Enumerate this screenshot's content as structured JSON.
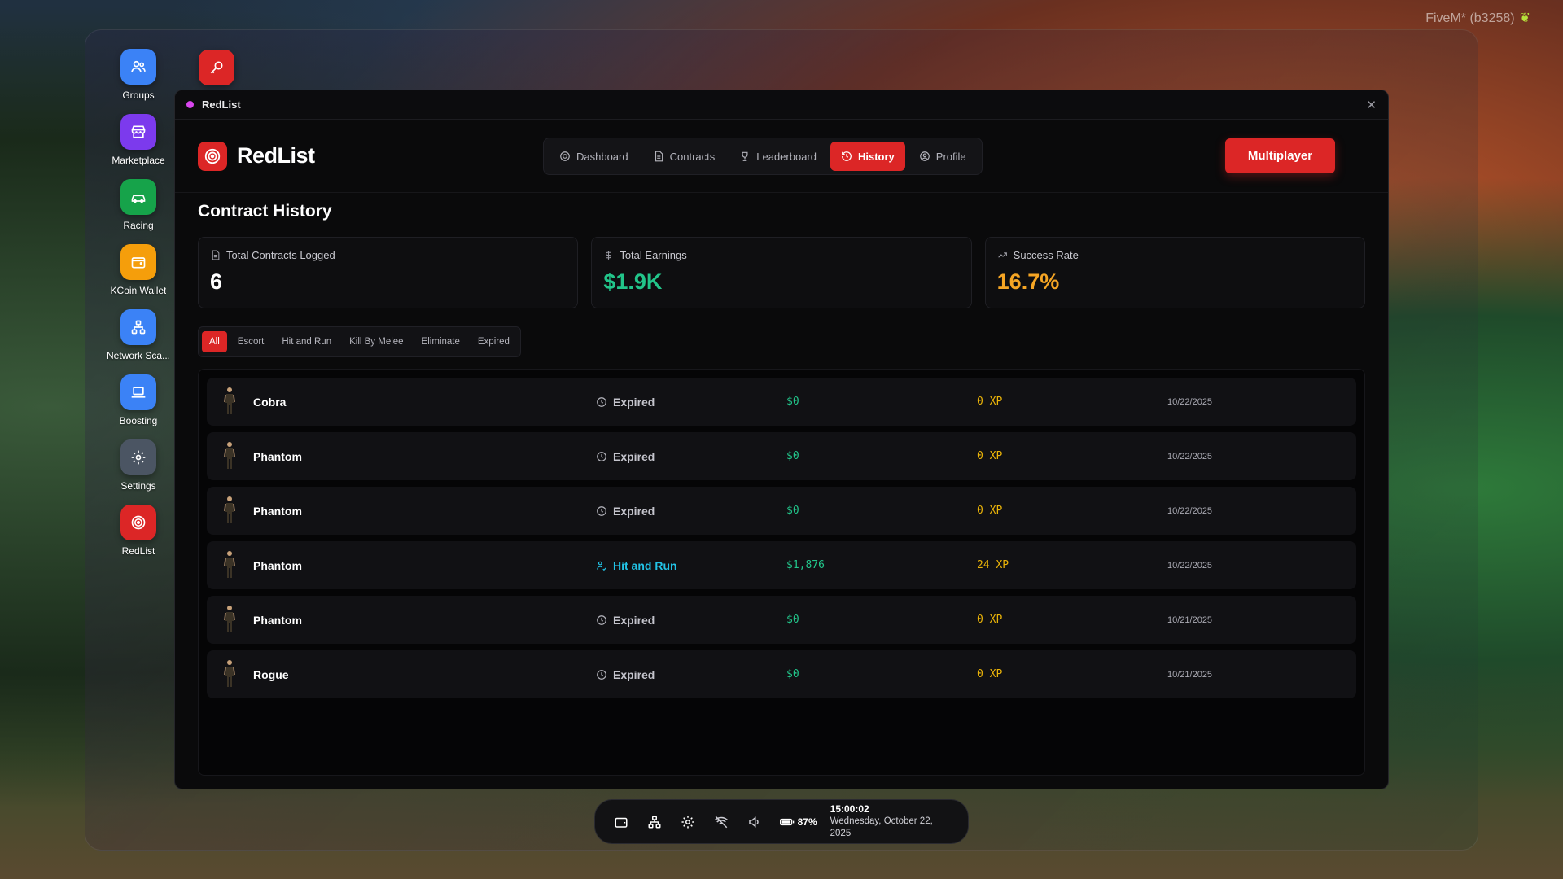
{
  "overlay": {
    "game_tag": "FiveM* (b3258)"
  },
  "dock": {
    "items": [
      {
        "label": "Groups",
        "icon": "users-icon",
        "color": "#3b82f6"
      },
      {
        "label": "Marketplace",
        "icon": "store-icon",
        "color": "#7c3aed"
      },
      {
        "label": "Racing",
        "icon": "car-icon",
        "color": "#16a34a"
      },
      {
        "label": "KCoin Wallet",
        "icon": "wallet-icon",
        "color": "#f59e0b"
      },
      {
        "label": "Network Sca...",
        "icon": "network-icon",
        "color": "#3b82f6"
      },
      {
        "label": "Boosting",
        "icon": "laptop-icon",
        "color": "#3b82f6"
      },
      {
        "label": "Settings",
        "icon": "gear-icon",
        "color": "#4b5563"
      },
      {
        "label": "RedList",
        "icon": "target-icon",
        "color": "#dc2626"
      }
    ]
  },
  "window": {
    "title": "RedList",
    "title_dot_color": "#d946ef"
  },
  "header": {
    "brand": "RedList",
    "tabs": [
      {
        "label": "Dashboard",
        "icon": "gauge-icon"
      },
      {
        "label": "Contracts",
        "icon": "document-icon"
      },
      {
        "label": "Leaderboard",
        "icon": "trophy-icon"
      },
      {
        "label": "History",
        "icon": "history-icon"
      },
      {
        "label": "Profile",
        "icon": "user-circle-icon"
      }
    ],
    "active_tab": "History",
    "multiplayer_label": "Multiplayer"
  },
  "page": {
    "title": "Contract History",
    "stats": [
      {
        "label": "Total Contracts Logged",
        "value": "6",
        "icon": "document-icon",
        "color": "#ffffff"
      },
      {
        "label": "Total Earnings",
        "value": "$1.9K",
        "icon": "dollar-icon",
        "color": "#22c58a"
      },
      {
        "label": "Success Rate",
        "value": "16.7%",
        "icon": "trending-up-icon",
        "color": "#f5a524"
      }
    ],
    "filters": [
      "All",
      "Escort",
      "Hit and Run",
      "Kill By Melee",
      "Eliminate",
      "Expired"
    ],
    "active_filter": "All",
    "rows": [
      {
        "name": "Cobra",
        "status": "Expired",
        "money": "$0",
        "xp": "0 XP",
        "date": "10/22/2025"
      },
      {
        "name": "Phantom",
        "status": "Expired",
        "money": "$0",
        "xp": "0 XP",
        "date": "10/22/2025"
      },
      {
        "name": "Phantom",
        "status": "Expired",
        "money": "$0",
        "xp": "0 XP",
        "date": "10/22/2025"
      },
      {
        "name": "Phantom",
        "status": "Hit and Run",
        "money": "$1,876",
        "xp": "24 XP",
        "date": "10/22/2025"
      },
      {
        "name": "Phantom",
        "status": "Expired",
        "money": "$0",
        "xp": "0 XP",
        "date": "10/21/2025"
      },
      {
        "name": "Rogue",
        "status": "Expired",
        "money": "$0",
        "xp": "0 XP",
        "date": "10/21/2025"
      }
    ]
  },
  "taskbar": {
    "battery": "87%",
    "time": "15:00:02",
    "date": "Wednesday, October 22, 2025"
  }
}
